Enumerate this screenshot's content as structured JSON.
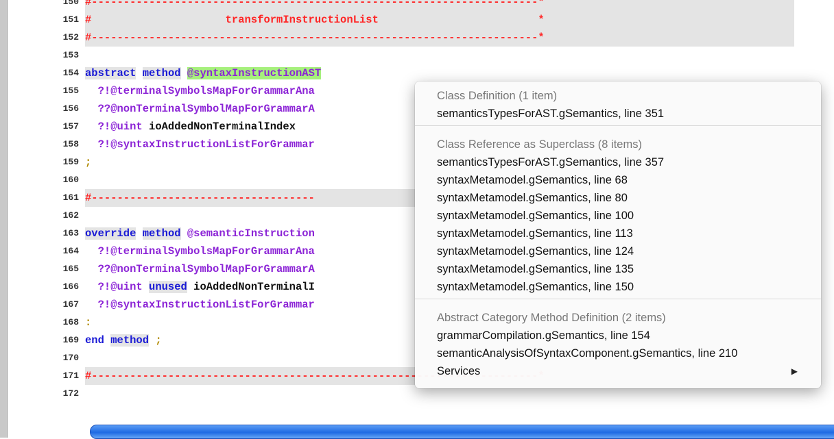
{
  "editor": {
    "lines": [
      {
        "num": "150",
        "text": "#----------------------------------------------------------------------*",
        "style": "red",
        "band": true
      },
      {
        "num": "151",
        "text": "#                     transformInstructionList                         *",
        "style": "red",
        "band": true
      },
      {
        "num": "152",
        "text": "#----------------------------------------------------------------------*",
        "style": "red",
        "band": true
      },
      {
        "num": "153",
        "text": ""
      },
      {
        "num": "154",
        "parts": [
          {
            "t": "abstract",
            "c": "kw",
            "hl": "grey"
          },
          {
            "t": " ",
            "c": "id"
          },
          {
            "t": "method",
            "c": "kw",
            "hl": "grey"
          },
          {
            "t": " ",
            "c": "id"
          },
          {
            "t": "@syntaxInstructionAST",
            "c": "typ",
            "hl": "green"
          }
        ]
      },
      {
        "num": "155",
        "parts": [
          {
            "t": "  ?!@terminalSymbolsMapForGrammarAna",
            "c": "typ"
          }
        ]
      },
      {
        "num": "156",
        "parts": [
          {
            "t": "  ??@nonTerminalSymbolMapForGrammarA",
            "c": "typ"
          }
        ]
      },
      {
        "num": "157",
        "parts": [
          {
            "t": "  ?!@uint",
            "c": "typ"
          },
          {
            "t": " ioAddedNonTerminalIndex",
            "c": "id"
          }
        ]
      },
      {
        "num": "158",
        "parts": [
          {
            "t": "  ?!@syntaxInstructionListForGrammar",
            "c": "typ"
          }
        ]
      },
      {
        "num": "159",
        "parts": [
          {
            "t": ";",
            "c": "punc"
          }
        ]
      },
      {
        "num": "160",
        "text": ""
      },
      {
        "num": "161",
        "text": "#-----------------------------------",
        "style": "red",
        "band": true
      },
      {
        "num": "162",
        "text": ""
      },
      {
        "num": "163",
        "parts": [
          {
            "t": "override",
            "c": "kw",
            "hl": "grey"
          },
          {
            "t": " ",
            "c": "id"
          },
          {
            "t": "method",
            "c": "kw",
            "hl": "grey"
          },
          {
            "t": " @semanticInstruction",
            "c": "typ"
          }
        ]
      },
      {
        "num": "164",
        "parts": [
          {
            "t": "  ?!@terminalSymbolsMapForGrammarAna",
            "c": "typ"
          }
        ]
      },
      {
        "num": "165",
        "parts": [
          {
            "t": "  ??@nonTerminalSymbolMapForGrammarA",
            "c": "typ"
          }
        ]
      },
      {
        "num": "166",
        "parts": [
          {
            "t": "  ?!@uint",
            "c": "typ"
          },
          {
            "t": " ",
            "c": "id"
          },
          {
            "t": "unused",
            "c": "kw",
            "hl": "grey"
          },
          {
            "t": " ioAddedNonTerminalI",
            "c": "id"
          }
        ]
      },
      {
        "num": "167",
        "parts": [
          {
            "t": "  ?!@syntaxInstructionListForGrammar",
            "c": "typ"
          }
        ]
      },
      {
        "num": "168",
        "parts": [
          {
            "t": ":",
            "c": "punc"
          }
        ]
      },
      {
        "num": "169",
        "parts": [
          {
            "t": "end",
            "c": "kw"
          },
          {
            "t": " ",
            "c": "id"
          },
          {
            "t": "method",
            "c": "kw",
            "hl": "grey"
          },
          {
            "t": " ",
            "c": "id"
          },
          {
            "t": ";",
            "c": "punc"
          }
        ]
      },
      {
        "num": "170",
        "text": ""
      },
      {
        "num": "171",
        "text": "#----------------------------------------------------------------------*",
        "style": "red",
        "band": true
      },
      {
        "num": "172",
        "text": ""
      }
    ]
  },
  "menu": {
    "sections": [
      {
        "header": "Class Definition (1 item)",
        "items": [
          "semanticsTypesForAST.gSemantics, line 351"
        ]
      },
      {
        "header": "Class Reference as Superclass (8 items)",
        "items": [
          "semanticsTypesForAST.gSemantics, line 357",
          "syntaxMetamodel.gSemantics, line 68",
          "syntaxMetamodel.gSemantics, line 80",
          "syntaxMetamodel.gSemantics, line 100",
          "syntaxMetamodel.gSemantics, line 113",
          "syntaxMetamodel.gSemantics, line 124",
          "syntaxMetamodel.gSemantics, line 135",
          "syntaxMetamodel.gSemantics, line 150"
        ]
      },
      {
        "header": "Abstract Category Method Definition (2 items)",
        "items": [
          "grammarCompilation.gSemantics, line 154",
          "semanticAnalysisOfSyntaxComponent.gSemantics, line 210"
        ]
      }
    ],
    "services_label": "Services",
    "submenu_icon": "triangle-right-icon"
  },
  "colors": {
    "keyword": "#1a1ad6",
    "type": "#8c24d6",
    "comment_red": "#ff2626",
    "highlight_green": "#a6f07c",
    "highlight_grey": "#e4e4e4"
  }
}
